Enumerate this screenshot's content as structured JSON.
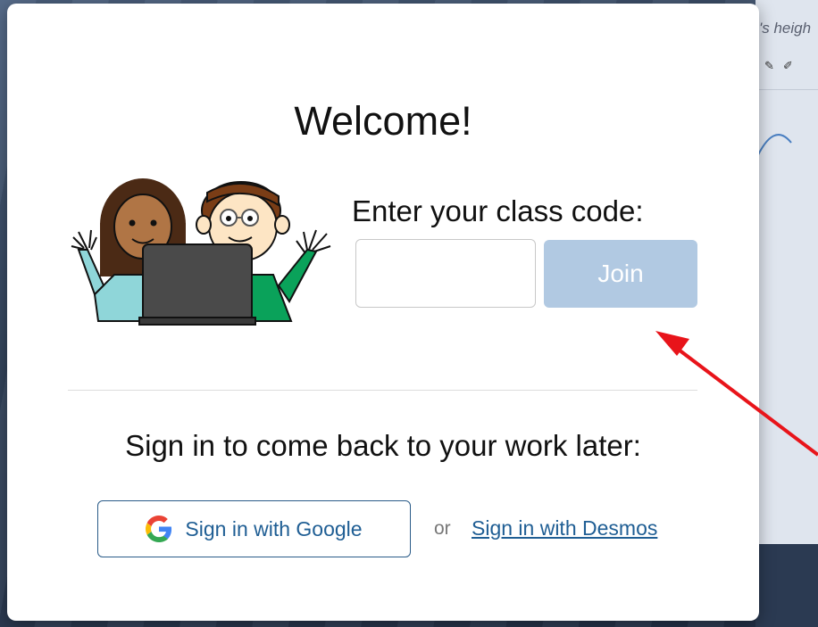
{
  "background": {
    "hint_text": "'s heigh"
  },
  "dialog": {
    "title": "Welcome!",
    "class_code": {
      "label": "Enter your class code:",
      "value": "",
      "placeholder": "",
      "join_label": "Join"
    },
    "signin": {
      "heading": "Sign in to come back to your work later:",
      "google_label": "Sign in with Google",
      "or_text": "or",
      "desmos_label": "Sign in with Desmos"
    }
  },
  "colors": {
    "join_button": "#b1c9e2",
    "link": "#1f5e94",
    "annotation_arrow": "#e8141a"
  },
  "icons": {
    "google": "google-g-icon",
    "illustration": "students-with-laptop-illustration",
    "annotation": "red-arrow-icon"
  }
}
